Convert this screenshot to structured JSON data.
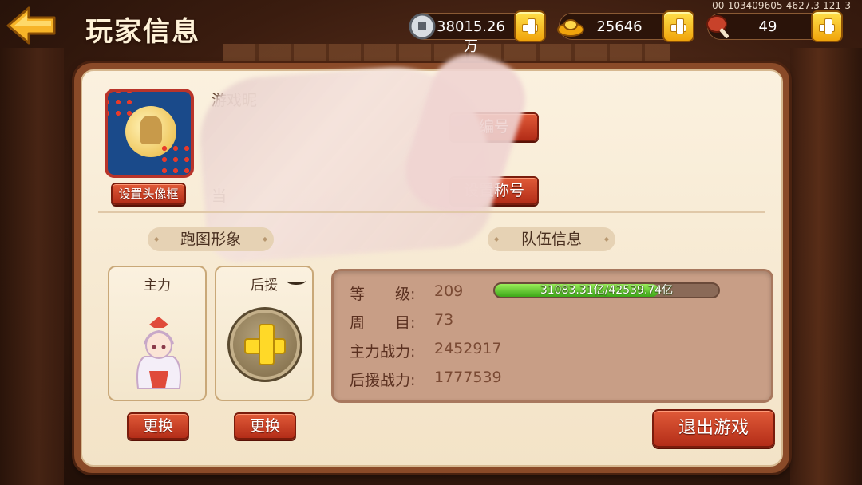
{
  "header": {
    "title": "玩家信息",
    "version": "00-103409605-4627.3-121-3"
  },
  "resources": [
    {
      "icon": "copper-coin-icon",
      "value": "38015.26万"
    },
    {
      "icon": "gold-ingot-icon",
      "value": "25646"
    },
    {
      "icon": "meat-drumstick-icon",
      "value": "49"
    }
  ],
  "profile": {
    "name_label": "游戏昵",
    "sub_label": "当",
    "set_frame_btn": "设置头像框",
    "id_btn": "编号",
    "set_title_btn": "设置称号"
  },
  "sections": {
    "map_look": "跑图形象",
    "team_info": "队伍信息"
  },
  "slots": {
    "main_label": "主力",
    "support_label": "后援",
    "change_btn": "更换"
  },
  "team": {
    "level_label": "等　　级:",
    "level": "209",
    "exp_text": "31083.31亿/42539.74亿",
    "exp_fraction": 0.731,
    "cycle_label": "周　　目:",
    "cycle": "73",
    "main_power_label": "主力战力:",
    "main_power": "2452917",
    "support_power_label": "后援战力:",
    "support_power": "1777539"
  },
  "exit_btn": "退出游戏",
  "colors": {
    "accent_red": "#c2361c",
    "gold": "#f0a40c",
    "exp_green": "#3ca818"
  }
}
